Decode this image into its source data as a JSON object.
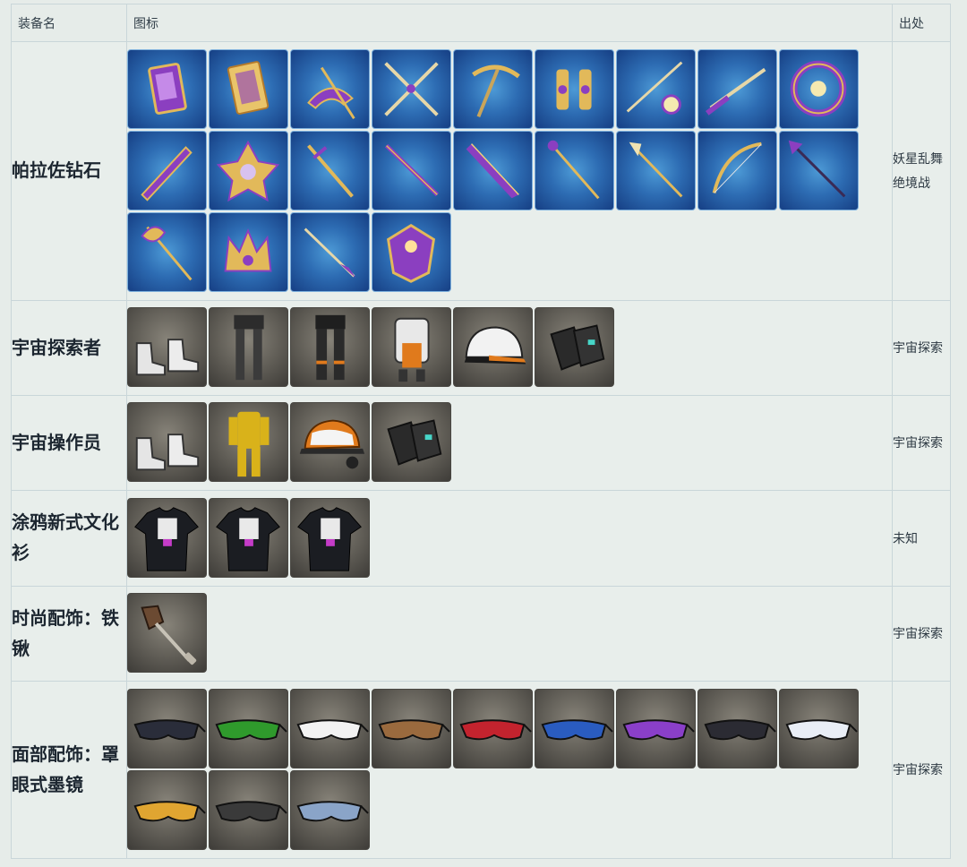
{
  "table": {
    "headers": {
      "name": "装备名",
      "icon": "图标",
      "source": "出处"
    },
    "rows": [
      {
        "name": "帕拉佐钻石",
        "source": "妖星乱舞绝境战",
        "tile_style": "blue",
        "icons": [
          "book-icon",
          "tome-icon",
          "scythe-blade-icon",
          "twin-blades-icon",
          "pickaxe-icon",
          "claws-icon",
          "rapier-orb-icon",
          "katana-icon",
          "chakram-icon",
          "greatsword-icon",
          "star-shield-icon",
          "sword-icon",
          "longsword-icon",
          "flame-sword-icon",
          "staff-icon",
          "scepter-icon",
          "bow-icon",
          "spear-icon",
          "battle-axe-icon",
          "crown-icon",
          "dagger-icon",
          "crystal-shield-icon"
        ]
      },
      {
        "name": "宇宙探索者",
        "source": "宇宙探索",
        "tile_style": "gray",
        "icons": [
          "boots-icon",
          "leggings-icon",
          "pants-icon",
          "body-armor-icon",
          "cap-icon",
          "gloves-icon"
        ]
      },
      {
        "name": "宇宙操作员",
        "source": "宇宙探索",
        "tile_style": "gray",
        "icons": [
          "boots-icon",
          "jumpsuit-icon",
          "headset-cap-icon",
          "gloves-icon"
        ]
      },
      {
        "name": "涂鸦新式文化衫",
        "source": "未知",
        "tile_style": "gray",
        "icons": [
          "tshirt-icon",
          "tshirt-icon",
          "tshirt-icon"
        ]
      },
      {
        "name": "时尚配饰：铁锹",
        "source": "宇宙探索",
        "tile_style": "gray",
        "icons": [
          "shovel-icon"
        ]
      },
      {
        "name": "面部配饰：罩眼式墨镜",
        "source": "宇宙探索",
        "tile_style": "gray",
        "icons": [
          "sunglasses-icon",
          "sunglasses-icon",
          "sunglasses-icon",
          "sunglasses-icon",
          "sunglasses-icon",
          "sunglasses-icon",
          "sunglasses-icon",
          "sunglasses-icon",
          "sunglasses-icon",
          "sunglasses-icon",
          "sunglasses-icon",
          "sunglasses-icon"
        ],
        "lens_colors": [
          "#2a2d3a",
          "#2f9a2c",
          "#f2f2f2",
          "#9a6a3e",
          "#c3232e",
          "#2a5cc0",
          "#8a3fc9",
          "#2b2b33",
          "#e9eef6",
          "#e0a531",
          "#3a3a3a",
          "#8aa4c8"
        ]
      }
    ]
  },
  "colors": {
    "weapon_gold": "#e2b95a",
    "weapon_purple": "#8b3fc0",
    "orange": "#e07a1c",
    "yellow": "#d9b21a"
  }
}
